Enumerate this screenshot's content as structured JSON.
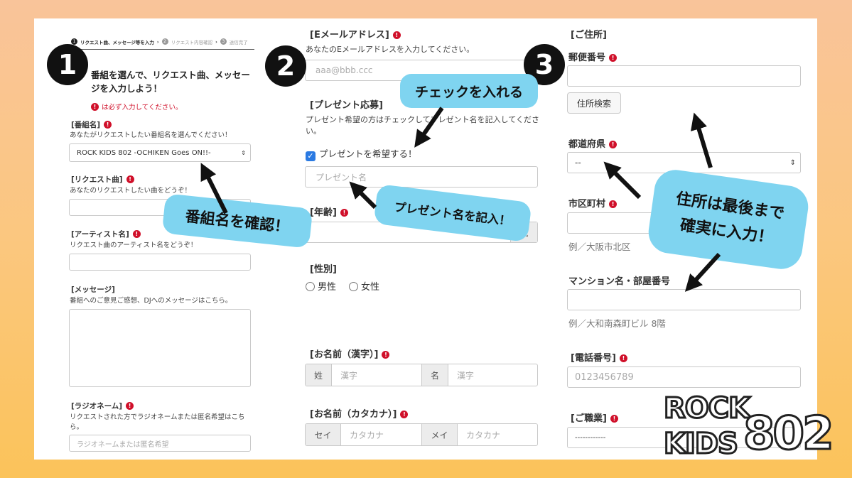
{
  "steps": {
    "step1": "リクエスト曲、メッセージ等を入力",
    "step2": "リクエスト内容確認",
    "step3": "送信完了"
  },
  "badges": [
    "1",
    "2",
    "3"
  ],
  "col1": {
    "heading": "番組を選んで、リクエスト曲、メッセージを入力しよう！",
    "required_note": "は必ず入力してください。",
    "program_label": "[番組名]",
    "program_hint": "あなたがリクエストしたい番組名を選んでください！",
    "program_value": "ROCK KIDS 802 -OCHIKEN Goes ON!!-",
    "song_label": "[リクエスト曲]",
    "song_hint": "あなたのリクエストしたい曲をどうぞ！",
    "artist_label": "[アーティスト名]",
    "artist_hint": "リクエスト曲のアーティスト名をどうぞ！",
    "message_label": "[メッセージ]",
    "message_hint": "番組へのご意見ご感想、DJへのメッセージはこちら。",
    "radioname_label": "[ラジオネーム]",
    "radioname_hint": "リクエストされた方でラジオネームまたは匿名希望はこちら。",
    "radioname_placeholder": "ラジオネームまたは匿名希望"
  },
  "col2": {
    "email_label": "[Eメールアドレス]",
    "email_hint": "あなたのEメールアドレスを入力してください。",
    "email_placeholder": "aaa@bbb.ccc",
    "present_label": "[プレゼント応募]",
    "present_hint": "プレゼント希望の方はチェックしてプレゼント名を記入してください。",
    "present_check": "プレゼントを希望する！",
    "present_placeholder": "プレゼント名",
    "age_label": "[年齢]",
    "age_suffix": "歳",
    "gender_label": "[性別]",
    "gender_male": "男性",
    "gender_female": "女性",
    "kanji_label": "[お名前（漢字）]",
    "sei": "姓",
    "mei": "名",
    "kanji_placeholder": "漢字",
    "kana_label": "[お名前（カタカナ）]",
    "sei_kana": "セイ",
    "mei_kana": "メイ",
    "kana_placeholder": "カタカナ"
  },
  "col3": {
    "address_label": "[ご住所]",
    "zip_label": "郵便番号",
    "zip_button": "住所検索",
    "pref_label": "都道府県",
    "pref_value": "--",
    "city_label": "市区町村",
    "city_example": "例／大阪市北区",
    "building_label": "マンション名・部屋番号",
    "building_example": "例／大和南森町ビル 8階",
    "phone_label": "[電話番号]",
    "phone_placeholder": "0123456789",
    "job_label": "[ご職業]",
    "job_value": "------------"
  },
  "callouts": {
    "program": "番組名を確認！",
    "check": "チェックを入れる",
    "present": "プレゼント名を記入！",
    "address": "住所は最後まで\n確実に入力！"
  },
  "logo": {
    "line1": "ROCK",
    "line2": "KIDS",
    "number": "802"
  },
  "colors": {
    "required": "#d0102a",
    "callout": "#7fd4f0",
    "check": "#2a7ae2"
  }
}
